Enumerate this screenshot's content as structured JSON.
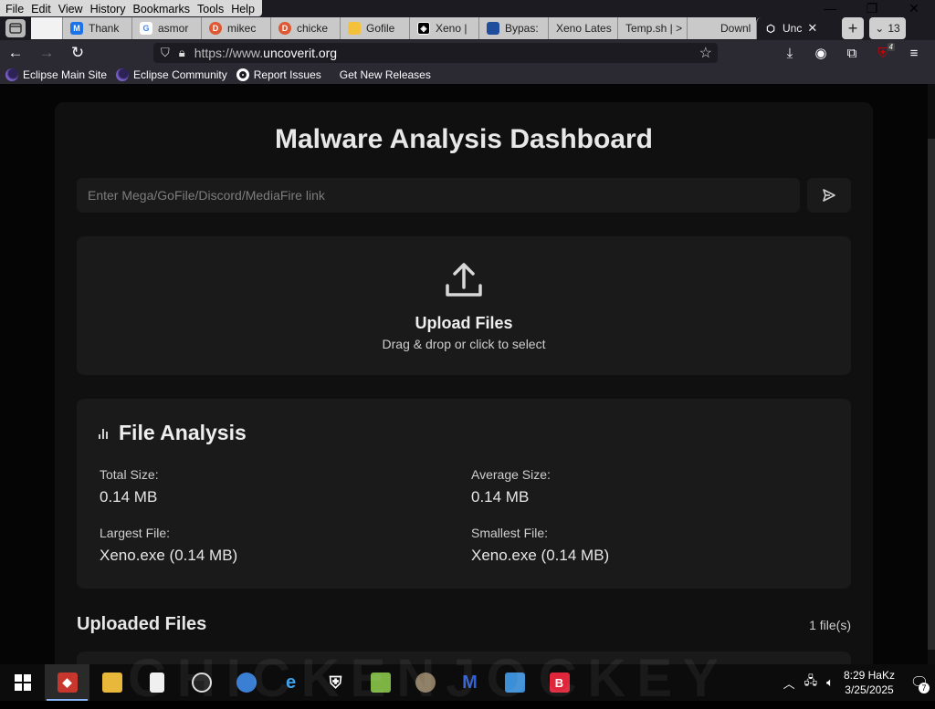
{
  "menu": {
    "items": [
      "File",
      "Edit",
      "View",
      "History",
      "Bookmarks",
      "Tools",
      "Help"
    ]
  },
  "tabs": [
    {
      "label": "Thank",
      "icon": "m-logo-icon",
      "color": "#1a73e8"
    },
    {
      "label": "asmor",
      "icon": "google-icon",
      "color": "#ffffff"
    },
    {
      "label": "mikec",
      "icon": "duckduckgo-icon",
      "color": "#de5833"
    },
    {
      "label": "chicke",
      "icon": "duckduckgo-icon",
      "color": "#de5833"
    },
    {
      "label": "Gofile",
      "icon": "folder-icon",
      "color": "#f3c13a"
    },
    {
      "label": "Xeno |",
      "icon": "xeno-icon",
      "color": "#000000"
    },
    {
      "label": "Bypas:",
      "icon": "bypass-icon",
      "color": "#1f4e9c"
    },
    {
      "label": "Xeno Lates",
      "icon": "",
      "color": ""
    },
    {
      "label": "Temp.sh | >",
      "icon": "",
      "color": ""
    },
    {
      "label": "Downl",
      "icon": "",
      "color": ""
    },
    {
      "label": "Unc",
      "icon": "shield-icon",
      "color": "#ffffff",
      "active": true
    }
  ],
  "tab_count": "13",
  "url": {
    "prefix": "https://www.",
    "domain": "uncoverit.org"
  },
  "toolbar_badge": "4",
  "bookmarks": [
    {
      "label": "Eclipse Main Site",
      "icon": "eclipse-icon"
    },
    {
      "label": "Eclipse Community",
      "icon": "eclipse-icon"
    },
    {
      "label": "Report Issues",
      "icon": "github-icon"
    },
    {
      "label": "Get New Releases",
      "icon": ""
    }
  ],
  "page": {
    "title": "Malware Analysis Dashboard",
    "link_placeholder": "Enter Mega/GoFile/Discord/MediaFire link",
    "upload": {
      "title": "Upload Files",
      "subtitle": "Drag & drop or click to select"
    },
    "analysis": {
      "title": "File Analysis",
      "stats": [
        {
          "label": "Total Size:",
          "value": "0.14 MB"
        },
        {
          "label": "Average Size:",
          "value": "0.14 MB"
        },
        {
          "label": "Largest File:",
          "value": "Xeno.exe (0.14 MB)"
        },
        {
          "label": "Smallest File:",
          "value": "Xeno.exe (0.14 MB)"
        }
      ]
    },
    "uploaded_title": "Uploaded Files",
    "file_count": "1 file(s)"
  },
  "taskbar": {
    "clock_time": "8:29 HaKz",
    "clock_date": "3/25/2025",
    "notifications": "7"
  },
  "watermark": "CHICKENJOCKEY"
}
